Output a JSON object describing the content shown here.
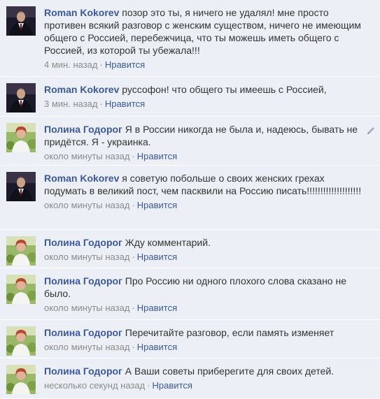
{
  "comments": [
    {
      "author": "Roman Kokorev",
      "text": "позор это ты, я ничего не удалял! мне просто противен всякий разговор с женским существом, ничего не имеющим общего с Россией, перебежчица, что ты можешь иметь общего с Россией, из которой ты убежала!!!",
      "time": "4 мин. назад",
      "like": "Нравится",
      "avatar": "man-in-suit-avatar"
    },
    {
      "author": "Roman Kokorev",
      "text": "руссофон! что общего ты имеешь с Россией,",
      "time": "3 мин. назад",
      "like": "Нравится",
      "avatar": "man-in-suit-avatar"
    },
    {
      "author": "Полина Годорог",
      "text": "Я в России никогда не была и, надеюсь, бывать не придётся. Я - украинка.",
      "time": "около минуты назад",
      "like": "Нравится",
      "avatar": "woman-in-garden-avatar"
    },
    {
      "author": "Roman Kokorev",
      "text": "я советую побольше о своих женских грехах подумать в великий пост, чем пасквили на Россию писать!!!!!!!!!!!!!!!!!!!!",
      "time": "около минуты назад",
      "like": "Нравится",
      "avatar": "man-in-suit-avatar"
    },
    {
      "author": "Полина Годорог",
      "text": "Жду комментарий.",
      "time": "около минуты назад",
      "like": "Нравится",
      "avatar": "woman-in-garden-avatar"
    },
    {
      "author": "Полина Годорог",
      "text": "Про Россию ни одного плохого слова сказано не было.",
      "time": "около минуты назад",
      "like": "Нравится",
      "avatar": "woman-in-garden-avatar"
    },
    {
      "author": "Полина Годорог",
      "text": "Перечитайте разговор, если память изменяет",
      "time": "около минуты назад",
      "like": "Нравится",
      "avatar": "woman-in-garden-avatar"
    },
    {
      "author": "Полина Годорог",
      "text": "А Ваши советы приберегите для своих детей.",
      "time": "несколько секунд назад",
      "like": "Нравится",
      "avatar": "woman-in-garden-avatar"
    }
  ],
  "separator": "·",
  "colors": {
    "background": "#eceff5",
    "link": "#3b5998",
    "meta": "#8b8b8b",
    "text": "#333333"
  },
  "icons": {
    "edit": "pencil-icon"
  }
}
